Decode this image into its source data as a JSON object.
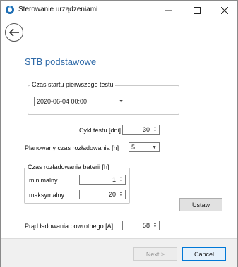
{
  "window": {
    "title": "Sterowanie urządzeniami"
  },
  "icons": {
    "app": "app-logo-icon",
    "minimize": "minimize-icon",
    "maximize": "maximize-icon",
    "close": "close-icon",
    "back": "back-arrow-icon"
  },
  "page": {
    "title": "STB podstawowe"
  },
  "first_test": {
    "group_label": "Czas startu pierwszego testu",
    "datetime_value": "2020-06-04 00:00"
  },
  "cycle": {
    "label": "Cykl testu [dni]",
    "value": "30"
  },
  "planned_discharge": {
    "label": "Planowany czas rozładowania [h]",
    "value": "5"
  },
  "battery_discharge": {
    "group_label": "Czas rozładowania baterii [h]",
    "min_label": "minimalny",
    "min_value": "1",
    "max_label": "maksymalny",
    "max_value": "20"
  },
  "set_button": "Ustaw",
  "return_current": {
    "label": "Prąd ładowania powrotnego [A]",
    "value": "58"
  },
  "footer": {
    "next": "Next >",
    "cancel": "Cancel"
  },
  "colors": {
    "accent_title": "#2f6aa8",
    "primary_border": "#0078d7"
  }
}
